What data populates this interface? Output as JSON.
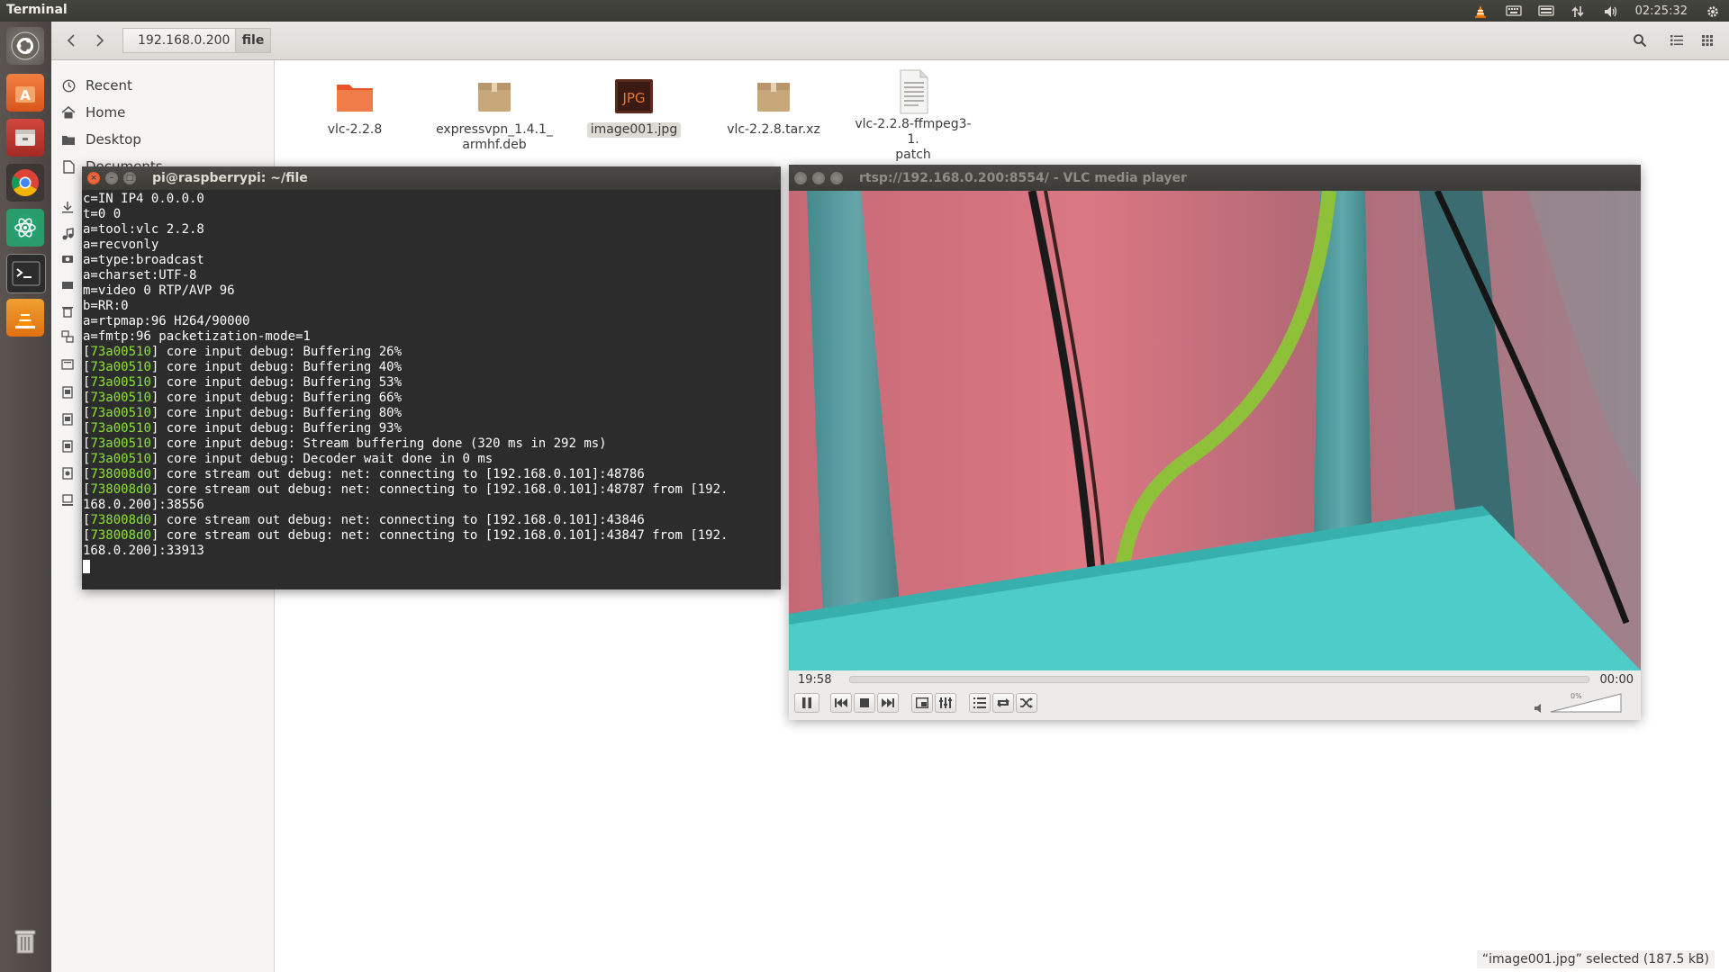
{
  "topbar": {
    "title": "Terminal",
    "clock": "02:25:32"
  },
  "file_manager": {
    "breadcrumb": [
      "192.168.0.200",
      "file"
    ],
    "sidebar": [
      "Recent",
      "Home",
      "Desktop",
      "Documents"
    ],
    "files": [
      {
        "name_line1": "vlc-2.2.8",
        "name_line2": "",
        "kind": "folder"
      },
      {
        "name_line1": "expressvpn_1.4.1_",
        "name_line2": "armhf.deb",
        "kind": "package"
      },
      {
        "name_line1": "image001.jpg",
        "name_line2": "",
        "kind": "jpg",
        "badge": "JPG",
        "selected": true
      },
      {
        "name_line1": "vlc-2.2.8.tar.xz",
        "name_line2": "",
        "kind": "archive"
      },
      {
        "name_line1": "vlc-2.2.8-ffmpeg3-1.",
        "name_line2": "patch",
        "kind": "text"
      }
    ],
    "status": "“image001.jpg” selected  (187.5 kB)"
  },
  "terminal": {
    "title": "pi@raspberrypi: ~/file",
    "lines": [
      {
        "p": "",
        "t": "c=IN IP4 0.0.0.0"
      },
      {
        "p": "",
        "t": "t=0 0"
      },
      {
        "p": "",
        "t": "a=tool:vlc 2.2.8"
      },
      {
        "p": "",
        "t": "a=recvonly"
      },
      {
        "p": "",
        "t": "a=type:broadcast"
      },
      {
        "p": "",
        "t": "a=charset:UTF-8"
      },
      {
        "p": "",
        "t": "m=video 0 RTP/AVP 96"
      },
      {
        "p": "",
        "t": "b=RR:0"
      },
      {
        "p": "",
        "t": "a=rtpmap:96 H264/90000"
      },
      {
        "p": "",
        "t": "a=fmtp:96 packetization-mode=1"
      },
      {
        "p": "",
        "t": ""
      },
      {
        "p": "[73a00510]",
        "t": " core input debug: Buffering 26%"
      },
      {
        "p": "[73a00510]",
        "t": " core input debug: Buffering 40%"
      },
      {
        "p": "[73a00510]",
        "t": " core input debug: Buffering 53%"
      },
      {
        "p": "[73a00510]",
        "t": " core input debug: Buffering 66%"
      },
      {
        "p": "[73a00510]",
        "t": " core input debug: Buffering 80%"
      },
      {
        "p": "[73a00510]",
        "t": " core input debug: Buffering 93%"
      },
      {
        "p": "[73a00510]",
        "t": " core input debug: Stream buffering done (320 ms in 292 ms)"
      },
      {
        "p": "[73a00510]",
        "t": " core input debug: Decoder wait done in 0 ms"
      },
      {
        "p": "[738008d0]",
        "t": " core stream out debug: net: connecting to [192.168.0.101]:48786"
      },
      {
        "p": "[738008d0]",
        "t": " core stream out debug: net: connecting to [192.168.0.101]:48787 from [192."
      },
      {
        "p": "",
        "t": "168.0.200]:38556"
      },
      {
        "p": "[738008d0]",
        "t": " core stream out debug: net: connecting to [192.168.0.101]:43846"
      },
      {
        "p": "[738008d0]",
        "t": " core stream out debug: net: connecting to [192.168.0.101]:43847 from [192."
      },
      {
        "p": "",
        "t": "168.0.200]:33913"
      }
    ]
  },
  "vlc": {
    "title": "rtsp://192.168.0.200:8554/ - VLC media player",
    "elapsed": "19:58",
    "remaining": "00:00",
    "volume_label": "0%",
    "volume": 0
  }
}
